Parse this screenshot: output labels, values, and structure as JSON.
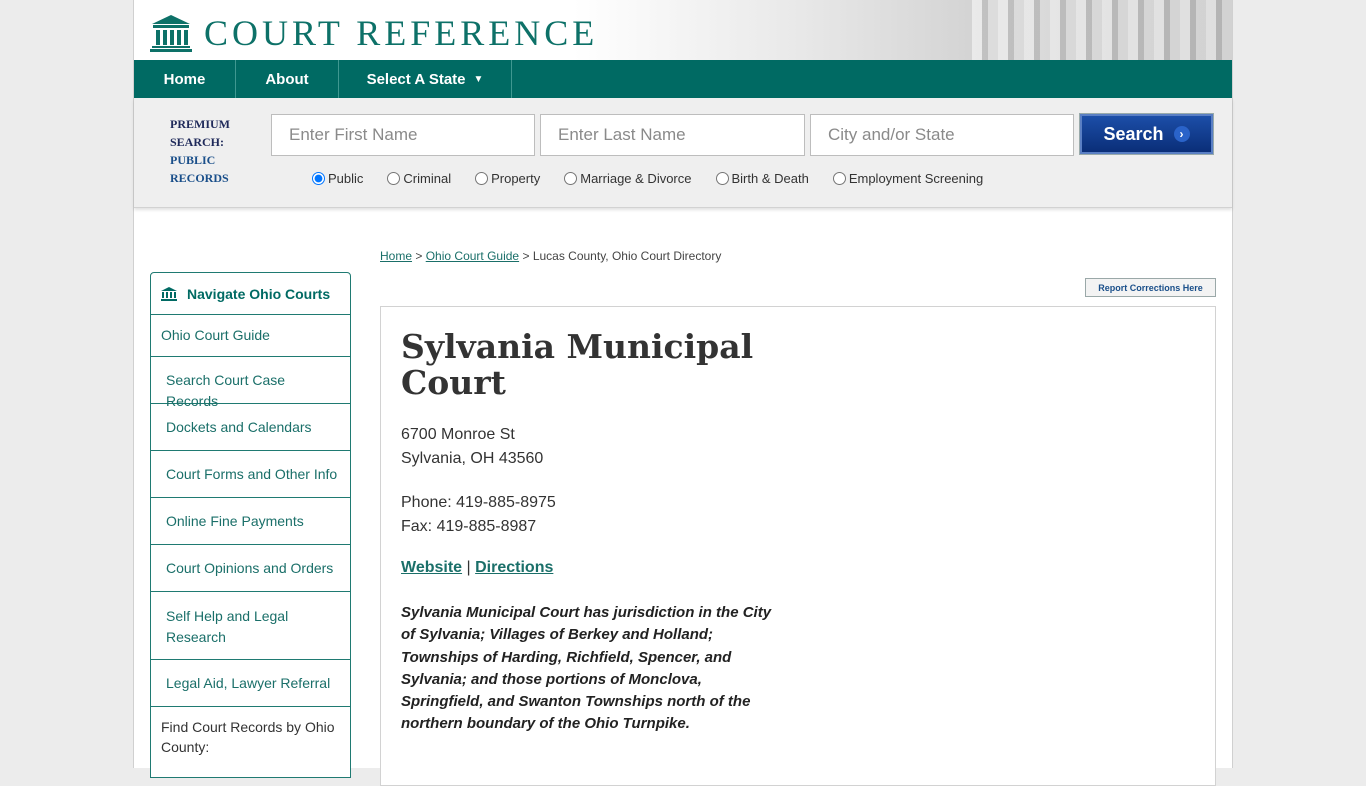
{
  "header": {
    "logo_text": "COURT REFERENCE"
  },
  "nav": {
    "home": "Home",
    "about": "About",
    "select_state": "Select A State"
  },
  "search": {
    "premium_line1": "PREMIUM",
    "premium_line2": "SEARCH:",
    "premium_line3": "PUBLIC",
    "premium_line4": "RECORDS",
    "first_name_placeholder": "Enter First Name",
    "last_name_placeholder": "Enter Last Name",
    "city_placeholder": "City and/or State",
    "button_label": "Search",
    "radio_options": [
      "Public",
      "Criminal",
      "Property",
      "Marriage & Divorce",
      "Birth & Death",
      "Employment Screening"
    ],
    "selected": "Public"
  },
  "sidebar": {
    "heading": "Navigate Ohio Courts",
    "top_item": "Ohio Court Guide",
    "items": [
      "Search Court Case Records",
      "Dockets and Calendars",
      "Court Forms and Other Info",
      "Online Fine Payments",
      "Court Opinions and Orders",
      "Self Help and Legal Research",
      "Legal Aid, Lawyer Referral"
    ],
    "county_label": "Find Court Records by Ohio County:"
  },
  "breadcrumb": {
    "home": "Home",
    "sep": ">",
    "guide": "Ohio Court Guide",
    "current": "Lucas County, Ohio Court Directory"
  },
  "report_button": "Report Corrections Here",
  "court": {
    "title": "Sylvania Municipal Court",
    "address_line1": "6700 Monroe St",
    "address_line2": "Sylvania, OH 43560",
    "phone": "Phone: 419-885-8975",
    "fax": "Fax: 419-885-8987",
    "website_label": "Website",
    "link_separator": "|",
    "directions_label": "Directions",
    "description": "Sylvania Municipal Court has jurisdiction in the City of Sylvania; Villages of Berkey and Holland; Townships of Harding, Richfield, Spencer, and Sylvania; and those portions of Monclova, Springfield, and Swanton Townships north of the northern boundary of the Ohio Turnpike."
  },
  "colors": {
    "brand_teal": "#006a63",
    "link_teal": "#1a6f69",
    "search_blue": "#0a2e78"
  }
}
